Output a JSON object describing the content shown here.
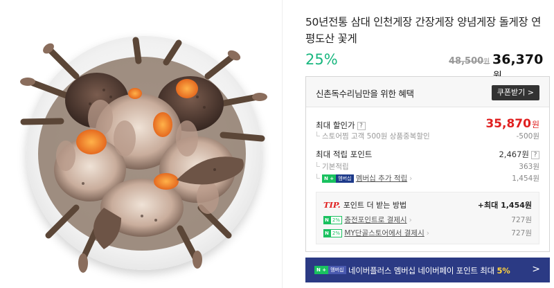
{
  "product": {
    "title": "50년전통 삼대 인천게장 간장게장 양념게장 돌게장 연평도산 꽃게",
    "discount_rate": "25%",
    "original_price": "48,500",
    "original_price_unit": "원",
    "sale_price": "36,370",
    "sale_price_unit": "원"
  },
  "benefit": {
    "heading": "신촌독수리님만을 위한 혜택",
    "coupon_button": "쿠폰받기 >",
    "max_discount_label": "최대 할인가",
    "max_discount_q": "?",
    "max_discount_value": "35,870",
    "max_discount_unit": "원",
    "store_coupon_label": "스토어찜 고객 500원 상품중복할인",
    "store_coupon_value": "-500원",
    "max_points_label": "최대 적립 포인트",
    "max_points_q": "?",
    "max_points_value": "2,467원",
    "basic_points_label": "기본적립",
    "basic_points_value": "363원",
    "membership_badge_n": "N +",
    "membership_badge_m": "멤버십",
    "membership_points_label": "멤버십 추가 적립",
    "membership_points_value": "1,454원"
  },
  "tip": {
    "mark": "TIP.",
    "title": "포인트 더 받는 방법",
    "max_value": "+최대 1,454원",
    "items": [
      {
        "badge_n": "N",
        "badge_pct": "2%",
        "label": "충전포인트로 결제시",
        "value": "727원"
      },
      {
        "badge_n": "N",
        "badge_pct": "2%",
        "label": "MY단골스토어에서 결제시",
        "value": "727원"
      }
    ]
  },
  "banner": {
    "badge_n": "N +",
    "badge_m": "멤버십",
    "text": "네이버플러스 멤버십 네이버페이 포인트 최대 ",
    "pct": "5%",
    "chevron": ">"
  },
  "colors": {
    "discount_green": "#19b77f",
    "price_red": "#e02020",
    "banner_navy": "#2b3a84",
    "banner_highlight": "#ffd23f"
  }
}
